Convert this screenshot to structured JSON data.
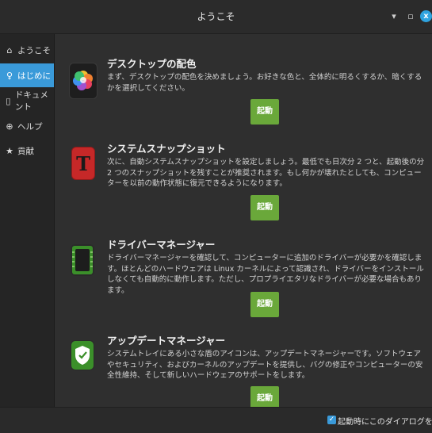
{
  "window": {
    "title": "ようこそ",
    "minimize_glyph": "▾",
    "maximize_glyph": "▫",
    "close_glyph": "x"
  },
  "sidebar": {
    "items": [
      {
        "label": "ようこそ",
        "icon": "home-icon",
        "glyph": "⌂"
      },
      {
        "label": "はじめに",
        "icon": "lightbulb-icon",
        "glyph": "♀"
      },
      {
        "label": "ドキュメント",
        "icon": "book-icon",
        "glyph": "▯"
      },
      {
        "label": "ヘルプ",
        "icon": "lifebuoy-icon",
        "glyph": "⊕"
      },
      {
        "label": "貢献",
        "icon": "star-icon",
        "glyph": "★"
      }
    ],
    "active_index": 1
  },
  "sections": [
    {
      "title": "デスクトップの配色",
      "icon": "color-palette-icon",
      "description": "まず、デスクトップの配色を決めましょう。お好きな色と、全体的に明るくするか、暗くするかを選択してください。",
      "button": "起動"
    },
    {
      "title": "システムスナップショット",
      "icon": "timeshift-icon",
      "description": "次に、自動システムスナップショットを設定しましょう。最低でも日次分 2 つと、起動後の分 2 つのスナップショットを残すことが推奨されます。もし何かが壊れたとしても、コンピューターを以前の動作状態に復元できるようになります。",
      "button": "起動"
    },
    {
      "title": "ドライバーマネージャー",
      "icon": "driver-chip-icon",
      "description": "ドライバーマネージャーを確認して、コンピューターに追加のドライバーが必要かを確認します。ほとんどのハードウェアは Linux カーネルによって認識され、ドライバーをインストールしなくても自動的に動作します。ただし、プロプライエタリなドライバーが必要な場合もあります。",
      "button": "起動"
    },
    {
      "title": "アップデートマネージャー",
      "icon": "update-shield-icon",
      "description": "システムトレイにある小さな盾のアイコンは、アップデートマネージャーです。ソフトウェアやセキュリティ、およびカーネルのアップデートを提供し、バグの修正やコンピューターの安全性維持、そして新しいハードウェアのサポートをします。",
      "button": "起動"
    }
  ],
  "footer": {
    "checkbox_label": "起動時にこのダイアログを表示",
    "checked": true,
    "check_glyph": "✓"
  },
  "colors": {
    "accent": "#3a9ad9",
    "launch_button": "#6aa83a",
    "background": "#2f2f2f",
    "sidebar": "#252525"
  }
}
